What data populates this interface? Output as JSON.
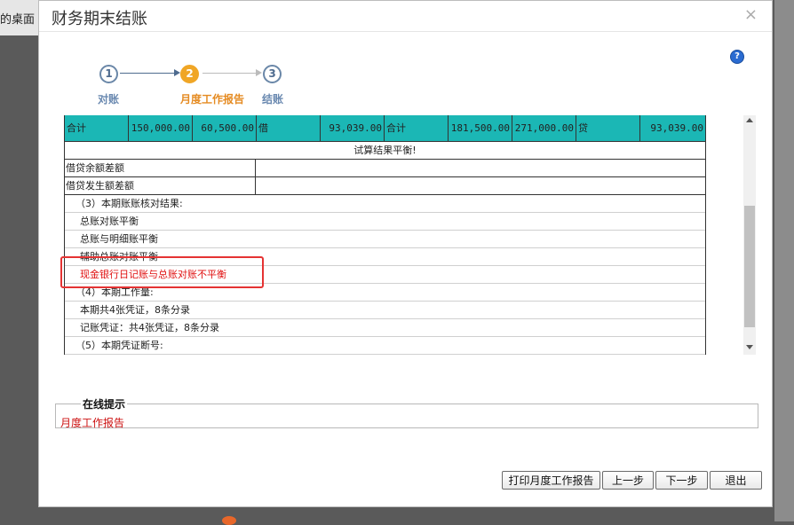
{
  "background": {
    "tab_label": "的桌面"
  },
  "dialog": {
    "title": "财务期末结账",
    "close_symbol": "×"
  },
  "help_icon": "?",
  "steps": [
    {
      "number": "1",
      "label": "对账",
      "active": false
    },
    {
      "number": "2",
      "label": "月度工作报告",
      "active": true
    },
    {
      "number": "3",
      "label": "结账",
      "active": false
    }
  ],
  "report": {
    "summary": {
      "left_label": "合计",
      "left_col1": "150,000.00",
      "left_col2": "60,500.00",
      "left_direction": "借",
      "left_balance": "93,039.00",
      "right_label": "合计",
      "right_col1": "181,500.00",
      "right_col2": "271,000.00",
      "right_direction": "贷",
      "right_balance": "93,039.00"
    },
    "balance_result": "试算结果平衡!",
    "diff_rows": [
      "借贷余额差额",
      "借贷发生额差额"
    ],
    "lines": [
      {
        "text": "（3）本期账账核对结果:",
        "style": "section"
      },
      {
        "text": "总账对账平衡",
        "style": "item"
      },
      {
        "text": "总账与明细账平衡",
        "style": "item"
      },
      {
        "text": "辅助总账对账平衡",
        "style": "item"
      },
      {
        "text": "现金银行日记账与总账对账不平衡",
        "style": "error"
      },
      {
        "text": "（4）本期工作量:",
        "style": "section"
      },
      {
        "text": "本期共4张凭证，8条分录",
        "style": "item"
      },
      {
        "text": "记账凭证：共4张凭证，8条分录",
        "style": "item"
      },
      {
        "text": "（5）本期凭证断号:",
        "style": "section"
      }
    ]
  },
  "tip": {
    "title": "在线提示",
    "text": "月度工作报告"
  },
  "buttons": {
    "print": "打印月度工作报告",
    "prev": "上一步",
    "next": "下一步",
    "exit": "退出"
  },
  "colors": {
    "summary_bg": "#1bb7b5",
    "active_step": "#f0a626",
    "error_text": "#e01010",
    "highlight_border": "#e53333"
  }
}
